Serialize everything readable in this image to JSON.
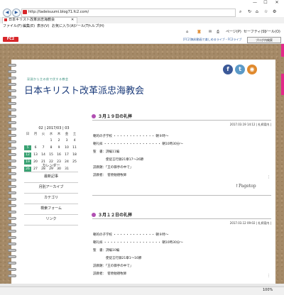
{
  "browser": {
    "url": "http://tadeisuumi.blog71.fc2.com/",
    "tab_title": "日本キリスト改革派忠海教会",
    "menu": [
      "ファイル(F)",
      "編集(E)",
      "表示(V)",
      "お気に入り(A)",
      "ツール(T)",
      "ヘルプ(H)"
    ],
    "toolbar": [
      "ページ(P)",
      "セーフティ(S)",
      "ツール(O)"
    ],
    "zoom": "100%"
  },
  "fc2bar": {
    "logo": "FC2",
    "link": "[FC2]無料動画で楽しめるライブ・FC2ライブ",
    "search_button": "ブログ内検索"
  },
  "blog": {
    "subtitle": "深淵から主の前で伏する教会",
    "title": "日本キリスト改革派忠海教会",
    "social": [
      {
        "name": "facebook",
        "glyph": "f",
        "color": "#3b5998"
      },
      {
        "name": "twitter",
        "glyph": "t",
        "color": "#5b9ac8"
      },
      {
        "name": "rss",
        "glyph": "◉",
        "color": "#e08a2e"
      }
    ]
  },
  "calendar": {
    "header": "02 | 2017/03 | 03",
    "dow": [
      "日",
      "月",
      "火",
      "水",
      "木",
      "金",
      "土"
    ],
    "weeks": [
      [
        "",
        "",
        "",
        "1",
        "2",
        "3",
        "4"
      ],
      [
        "5",
        "6",
        "7",
        "8",
        "9",
        "10",
        "11"
      ],
      [
        "12",
        "13",
        "14",
        "15",
        "16",
        "17",
        "18"
      ],
      [
        "19",
        "20",
        "21",
        "22",
        "23",
        "24",
        "25"
      ],
      [
        "26",
        "27",
        "28",
        "29",
        "30",
        "31",
        ""
      ]
    ],
    "highlighted": [
      "5",
      "12",
      "19",
      "26"
    ]
  },
  "sidebar": [
    "カレンダー",
    "最新記事",
    "月別アーカイブ",
    "カテゴリ",
    "検索フォーム",
    "リンク"
  ],
  "articles": [
    {
      "title": "３月１９日の礼拝",
      "meta": "2017.03.19 14:12 | 礼拝案内 |",
      "lines": [
        "朝的の子学校 ・・・・・・・・・・・・・ 朝９時〜",
        "朝礼拝 ・・・・・・・・・・・・・・・・・・ 朝10時30分〜",
        "聖　書：詩編11編",
        "　　　　使徒言行録21章17〜26節",
        "説教題：「王の御手の中で」",
        "説教者：　菅原勉德牧師"
      ],
      "edit": "⋮"
    },
    {
      "title": "３月１２日の礼拝",
      "meta": "2017.03.12 09:02 | 礼拝案内 |",
      "lines": [
        "朝的の子学校 ・・・・・・・・・・・・・ 朝９時〜",
        "朝礼拝 ・・・・・・・・・・・・・・・・・・ 朝10時30分〜",
        "聖　書：詩編10編",
        "　　　　使徒言行録21章1〜16節",
        "説教題：「王の御手の中で」",
        "説教者：　菅原勉德牧師"
      ],
      "edit": "⋮"
    }
  ],
  "pagetop": "↑Pagetop"
}
